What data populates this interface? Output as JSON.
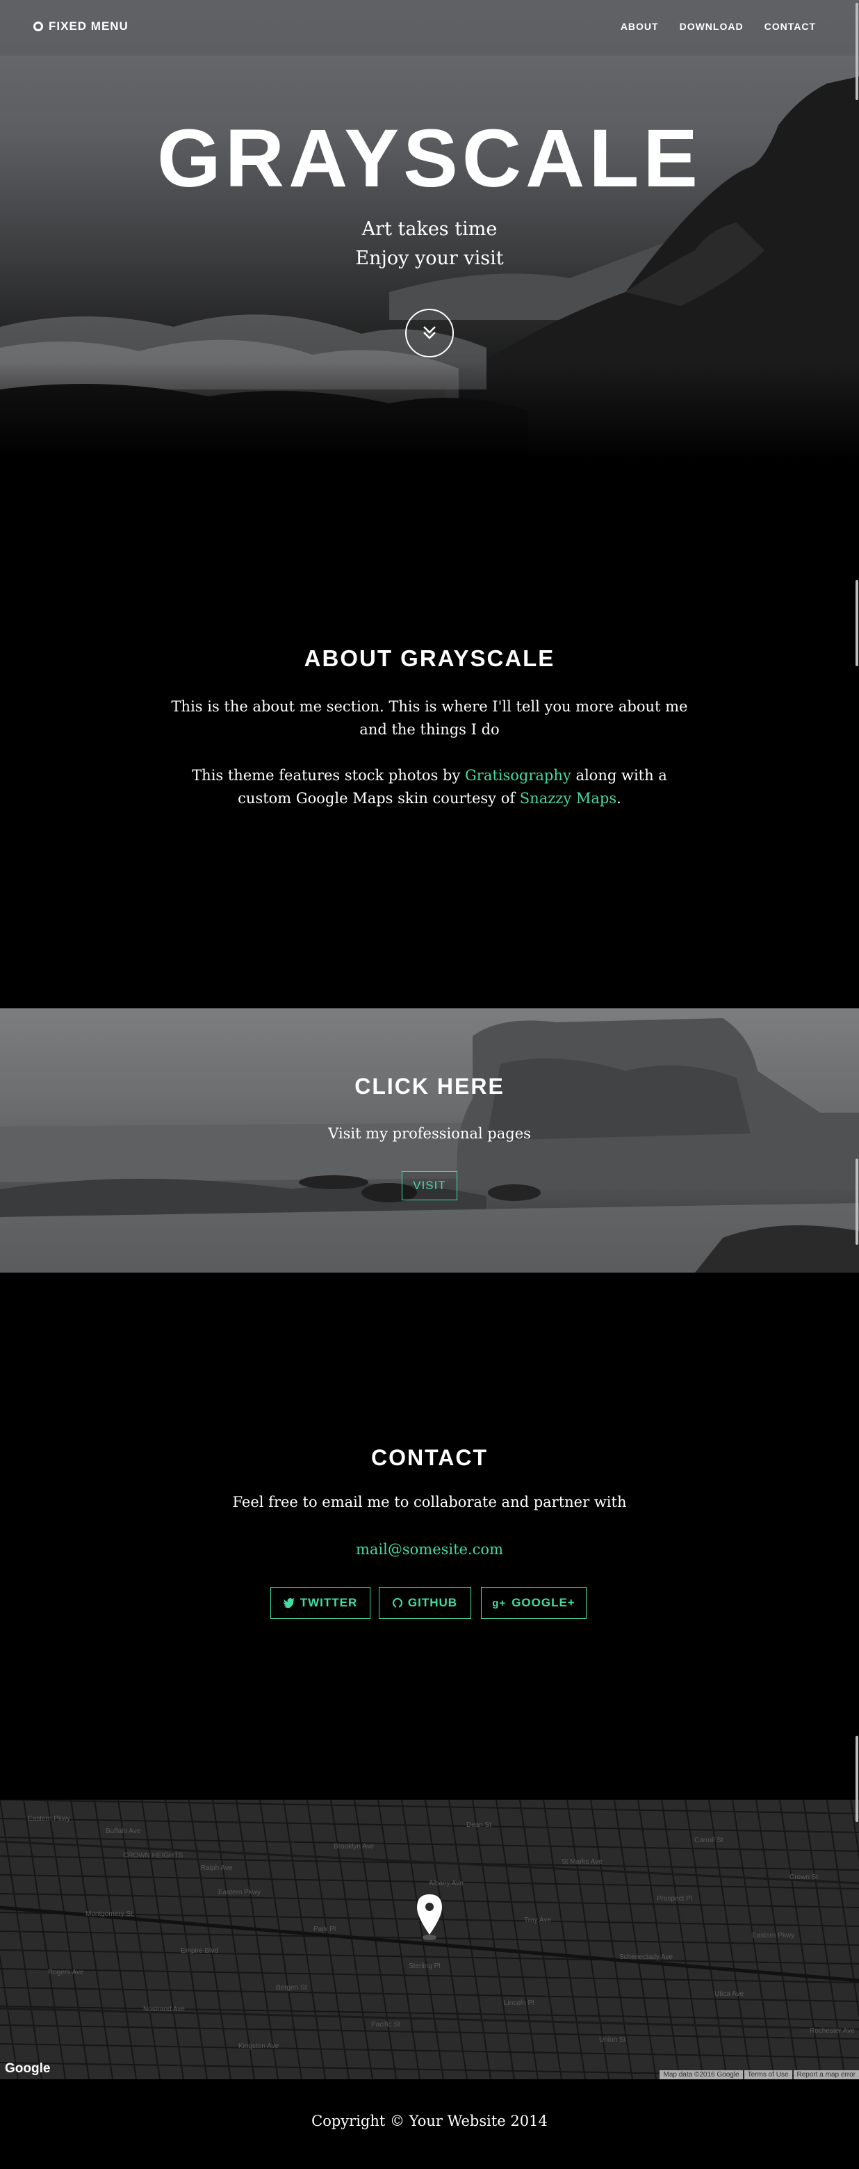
{
  "nav": {
    "brand": "FIXED MENU",
    "links": [
      "ABOUT",
      "DOWNLOAD",
      "CONTACT"
    ]
  },
  "hero": {
    "title": "GRAYSCALE",
    "subtitle_line1": "Art takes time",
    "subtitle_line2": "Enjoy your visit",
    "scroll_icon": "double-chevron-down-icon"
  },
  "about": {
    "title": "ABOUT GRAYSCALE",
    "para1": "This is the about me section. This is where I'll tell you more about me and the things I do",
    "para2_before": "This theme features stock photos by ",
    "para2_link1": "Gratisography",
    "para2_middle": " along with a custom Google Maps skin courtesy of ",
    "para2_link2": "Snazzy Maps",
    "para2_after": "."
  },
  "cta": {
    "title": "CLICK HERE",
    "subtitle": "Visit my professional pages",
    "button": "VISIT"
  },
  "contact": {
    "title": "CONTACT",
    "subtitle": "Feel free to email me to collaborate and partner with",
    "email": "mail@somesite.com",
    "buttons": [
      {
        "label": "TWITTER",
        "icon": "twitter-icon"
      },
      {
        "label": "GITHUB",
        "icon": "github-icon"
      },
      {
        "label": "GOOGLE+",
        "icon": "google-plus-icon"
      }
    ]
  },
  "map": {
    "logo": "Google",
    "attribution": [
      "Map data ©2016 Google",
      "Terms of Use",
      "Report a map error"
    ],
    "street_labels": [
      "Eastern Pkwy",
      "CROWN HEIGHTS",
      "Eastern Pkwy",
      "Park Pl",
      "Sterling Pl",
      "Lincoln Pl",
      "Union St",
      "Carroll St",
      "Crown St",
      "Montgomery St",
      "Empire Blvd",
      "Bergen St",
      "Pacific St",
      "Dean St",
      "St Marks Ave",
      "Prospect Pl",
      "Eastern Pkwy",
      "Rogers Ave",
      "Nostrand Ave",
      "Kingston Ave",
      "Brooklyn Ave",
      "Albany Ave",
      "Troy Ave",
      "Schenectady Ave",
      "Utica Ave",
      "Rochester Ave",
      "Buffalo Ave",
      "Ralph Ave"
    ]
  },
  "footer": {
    "copyright": "Copyright © Your Website 2014"
  },
  "colors": {
    "accent": "#42dca3",
    "background": "#000000",
    "text": "#ffffff"
  }
}
